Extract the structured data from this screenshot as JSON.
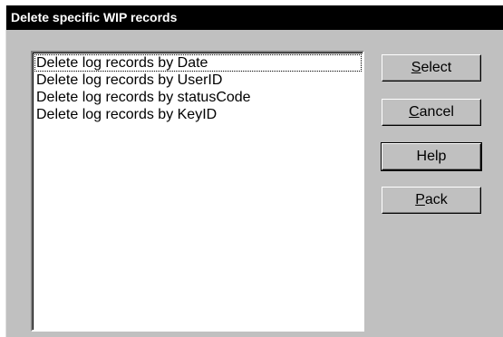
{
  "window": {
    "title": "Delete specific WIP records"
  },
  "list": {
    "items": [
      "Delete log records by Date",
      "Delete log records by UserID",
      "Delete log records by statusCode",
      "Delete log records by KeyID"
    ]
  },
  "buttons": {
    "select": {
      "mnemonic": "S",
      "rest": "elect"
    },
    "cancel": {
      "mnemonic": "C",
      "rest": "ancel"
    },
    "help": {
      "label": "Help"
    },
    "pack": {
      "mnemonic": "P",
      "rest": "ack"
    }
  }
}
